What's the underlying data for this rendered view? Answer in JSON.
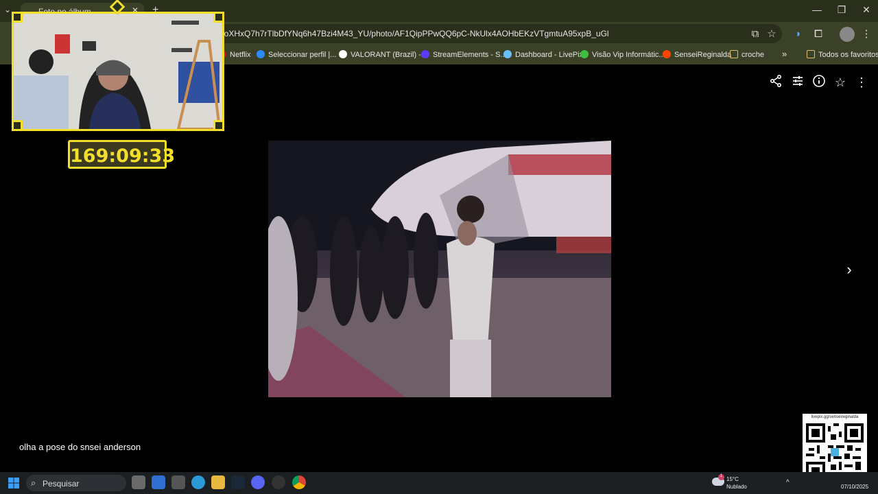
{
  "browser": {
    "tab_title": "Foto no álbum ...",
    "url": "joXHxQ7h7rTlbDfYNq6h47Bzi4M43_YU/photo/AF1QipPPwQQ6pC-NkUlx4AOHbEKzVTgmtuA95xpB_uGl",
    "bookmarks": [
      {
        "label": "Netflix",
        "color": "#e50914"
      },
      {
        "label": "Seleccionar perfil |...",
        "color": "#2a8cff"
      },
      {
        "label": "VALORANT (Brazil) -...",
        "color": "#ffffff"
      },
      {
        "label": "StreamElements - S...",
        "color": "#5b3bff"
      },
      {
        "label": "Dashboard - LivePix",
        "color": "#69c0ff"
      },
      {
        "label": "Visão Vip Informátic...",
        "color": "#3fbf3f"
      },
      {
        "label": "SenseiReginalda",
        "color": "#ff4500"
      },
      {
        "label": "croche",
        "color": "#e0c070"
      }
    ],
    "all_favorites": "Todos os favoritos",
    "more_bookmarks": "»"
  },
  "viewer": {
    "toolbar_icons": [
      "share-icon",
      "adjust-icon",
      "info-icon",
      "star-icon",
      "more-vert-icon"
    ]
  },
  "overlay": {
    "timer": "169:09:33",
    "caption": "olha a pose do snsei anderson",
    "qr_label": "livepix.gg/senseireginalda"
  },
  "taskbar": {
    "search_placeholder": "Pesquisar",
    "weather_temp": "15°C",
    "weather_desc": "Nublado",
    "weather_badge": "1",
    "date": "07/10/2025"
  },
  "colors": {
    "accent_yellow": "#f3df2a",
    "chrome_bg": "#3b4127"
  }
}
